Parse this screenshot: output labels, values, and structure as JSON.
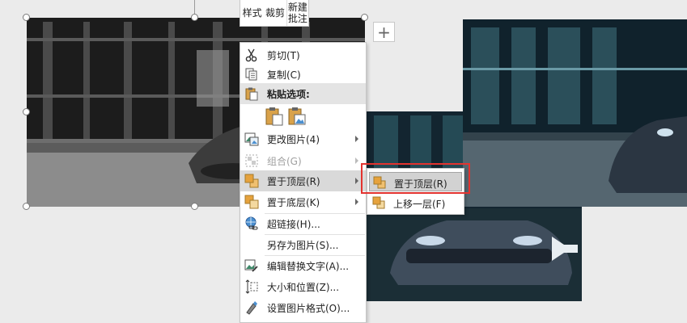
{
  "mini_toolbar": {
    "style": "样式",
    "crop": "裁剪",
    "new_comment": "新建\n批注"
  },
  "plus_button": "+",
  "context_menu": {
    "cut": "剪切(T)",
    "copy": "复制(C)",
    "paste_options": "粘贴选项:",
    "change_picture": "更改图片(4)",
    "group": "组合(G)",
    "bring_to_front": "置于顶层(R)",
    "send_to_back": "置于底层(K)",
    "hyperlink": "超链接(H)...",
    "save_as_picture": "另存为图片(S)...",
    "edit_alt_text": "编辑替换文字(A)...",
    "size_position": "大小和位置(Z)...",
    "format_picture": "设置图片格式(O)..."
  },
  "submenu": {
    "bring_to_front": "置于顶层(R)",
    "bring_forward": "上移一层(F)"
  },
  "colors": {
    "highlight_border": "#e3332f",
    "menu_hover": "#d9d9d9"
  },
  "icons": {
    "cut": "scissors-icon",
    "copy": "copy-icon",
    "paste": "clipboard-icon",
    "change_picture": "change-picture-icon",
    "group": "group-icon",
    "bring_front": "bring-to-front-icon",
    "send_back": "send-to-back-icon",
    "hyperlink": "link-icon",
    "alt_text": "alt-text-icon",
    "size": "size-position-icon",
    "format": "format-picture-icon"
  }
}
